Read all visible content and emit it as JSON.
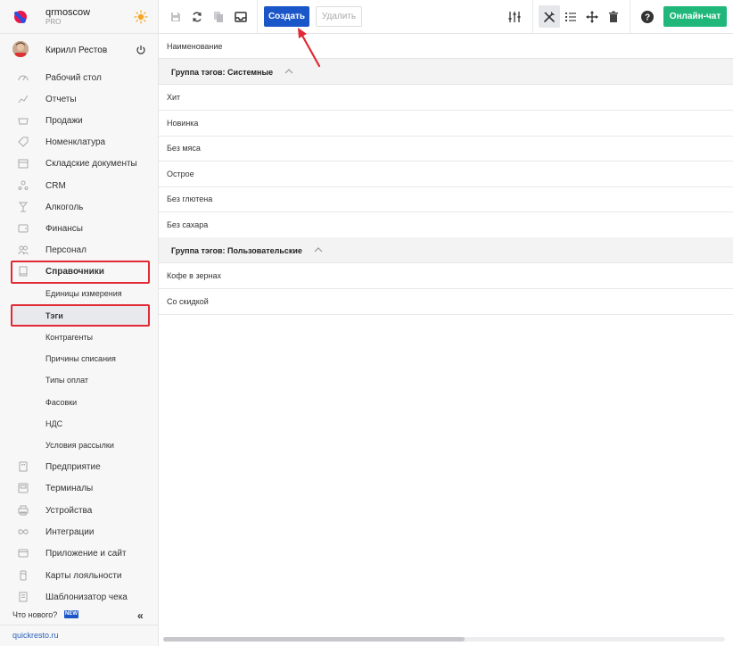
{
  "brand": {
    "name": "qrmoscow",
    "plan": "PRO"
  },
  "user": {
    "name": "Кирилл Рестов"
  },
  "sidebar": {
    "items": [
      {
        "label": "Рабочий стол",
        "icon": "dashboard-icon"
      },
      {
        "label": "Отчеты",
        "icon": "chart-icon"
      },
      {
        "label": "Продажи",
        "icon": "basket-icon"
      },
      {
        "label": "Номенклатура",
        "icon": "tag-icon"
      },
      {
        "label": "Складские документы",
        "icon": "warehouse-icon"
      },
      {
        "label": "CRM",
        "icon": "crm-icon"
      },
      {
        "label": "Алкоголь",
        "icon": "glass-icon"
      },
      {
        "label": "Финансы",
        "icon": "wallet-icon"
      },
      {
        "label": "Персонал",
        "icon": "people-icon"
      },
      {
        "label": "Справочники",
        "icon": "book-icon"
      }
    ],
    "subitems": [
      {
        "label": "Единицы измерения"
      },
      {
        "label": "Тэги"
      },
      {
        "label": "Контрагенты"
      },
      {
        "label": "Причины списания"
      },
      {
        "label": "Типы оплат"
      },
      {
        "label": "Фасовки"
      },
      {
        "label": "НДС"
      },
      {
        "label": "Условия рассылки"
      }
    ],
    "items_bottom": [
      {
        "label": "Предприятие",
        "icon": "building-icon"
      },
      {
        "label": "Терминалы",
        "icon": "terminal-icon"
      },
      {
        "label": "Устройства",
        "icon": "printer-icon"
      },
      {
        "label": "Интеграции",
        "icon": "infinity-icon"
      },
      {
        "label": "Приложение и сайт",
        "icon": "app-icon"
      },
      {
        "label": "Карты лояльности",
        "icon": "card-icon"
      },
      {
        "label": "Шаблонизатор чека",
        "icon": "receipt-icon"
      }
    ],
    "whats_new": "Что нового?",
    "new_badge": "NEW",
    "site": "quickresto.ru"
  },
  "toolbar": {
    "create_label": "Создать",
    "delete_label": "Удалить",
    "chat_label": "Онлайн-чат"
  },
  "table": {
    "column_header": "Наименование",
    "groups": [
      {
        "title": "Группа тэгов: Системные",
        "rows": [
          "Хит",
          "Новинка",
          "Без мяса",
          "Острое",
          "Без глютена",
          "Без сахара"
        ]
      },
      {
        "title": "Группа тэгов: Пользовательские",
        "rows": [
          "Кофе в зернах",
          "Со скидкой"
        ]
      }
    ]
  },
  "colors": {
    "accent": "#1a56c8",
    "chat": "#1fb87a",
    "highlight": "#e02a35"
  }
}
